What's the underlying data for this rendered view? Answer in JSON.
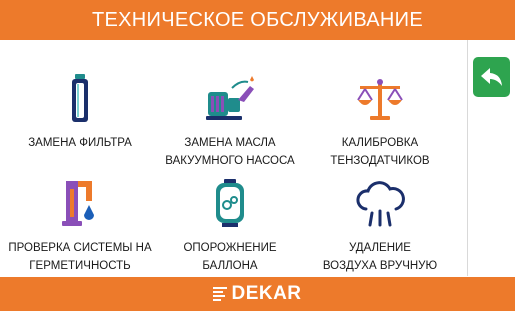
{
  "header": {
    "title": "ТЕХНИЧЕСКОЕ ОБСЛУЖИВАНИЕ"
  },
  "colors": {
    "accent": "#ed7a2b",
    "back_button": "#2ea44f",
    "icon_teal": "#1f8c8c",
    "icon_purple": "#8a4fb8",
    "icon_orange": "#ed7a2b"
  },
  "tiles": [
    {
      "icon": "filter-icon",
      "label": "ЗАМЕНА ФИЛЬТРА"
    },
    {
      "icon": "vacuum-pump-icon",
      "label": "ЗАМЕНА МАСЛА\nВАКУУМНОГО НАСОСА"
    },
    {
      "icon": "scale-icon",
      "label": "КАЛИБРОВКА\nТЕНЗОДАТЧИКОВ"
    },
    {
      "icon": "leak-test-icon",
      "label": "ПРОВЕРКА СИСТЕМЫ НА\nГЕРМЕТИЧНОСТЬ"
    },
    {
      "icon": "tank-icon",
      "label": "ОПОРОЖНЕНИЕ\nБАЛЛОНА"
    },
    {
      "icon": "cloud-air-icon",
      "label": "УДАЛЕНИЕ\nВОЗДУХА ВРУЧНУЮ"
    }
  ],
  "side": {
    "back_icon": "back-arrow-icon"
  },
  "footer": {
    "brand": "DEKAR"
  }
}
